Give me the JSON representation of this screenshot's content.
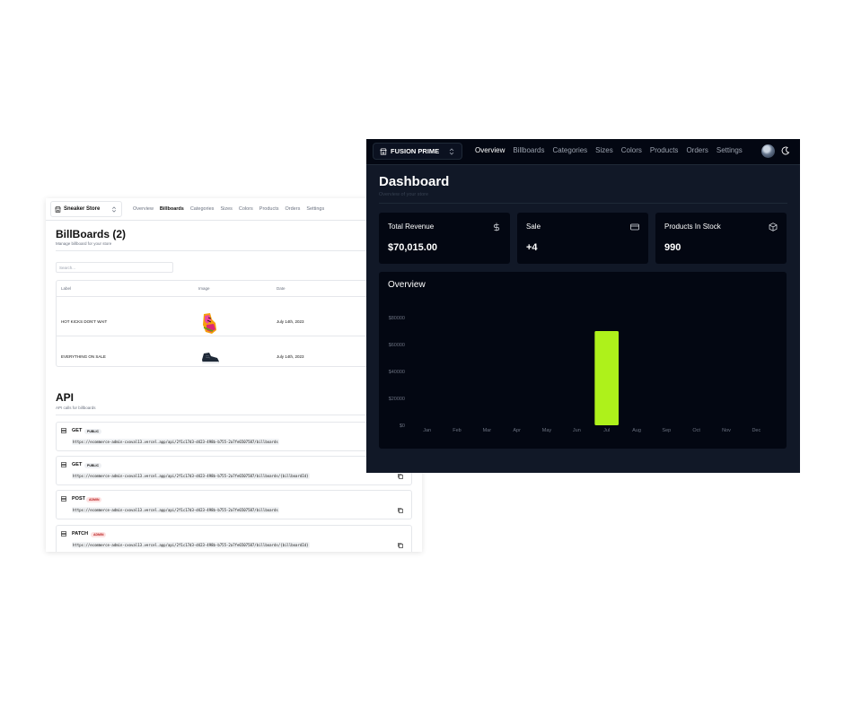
{
  "billboards_window": {
    "store_switcher": {
      "label": "Sneaker Store",
      "icon": "store-icon"
    },
    "nav": [
      {
        "label": "Overview",
        "active": false
      },
      {
        "label": "Billboards",
        "active": true
      },
      {
        "label": "Categories",
        "active": false
      },
      {
        "label": "Sizes",
        "active": false
      },
      {
        "label": "Colors",
        "active": false
      },
      {
        "label": "Products",
        "active": false
      },
      {
        "label": "Orders",
        "active": false
      },
      {
        "label": "Settings",
        "active": false
      }
    ],
    "heading": {
      "title": "BillBoards (2)",
      "subtitle": "Manage billboard for your store"
    },
    "search": {
      "placeholder": "Search..."
    },
    "table": {
      "headers": [
        "Label",
        "Image",
        "Date"
      ],
      "rows": [
        {
          "label": "HOT KICKS DON'T WAIT",
          "image": "sneaker-colorful",
          "date": "July 14th, 2023"
        },
        {
          "label": "EVERYTHING ON SALE",
          "image": "sneaker-black",
          "date": "July 14th, 2023"
        }
      ]
    },
    "api": {
      "title": "API",
      "subtitle": "API calls for billboards",
      "calls": [
        {
          "method": "GET",
          "badge": "PUBLIC",
          "url": "https://ecommerce-admin-cxoval13.vercel.app/api/2f1c17d3-d423-498b-b755-2a7fe6507587/billboards"
        },
        {
          "method": "GET",
          "badge": "PUBLIC",
          "url": "https://ecommerce-admin-cxoval13.vercel.app/api/2f1c17d3-d423-498b-b755-2a7fe6507587/billboards/{billboardId}"
        },
        {
          "method": "POST",
          "badge": "ADMIN",
          "url": "https://ecommerce-admin-cxoval13.vercel.app/api/2f1c17d3-d423-498b-b755-2a7fe6507587/billboards"
        },
        {
          "method": "PATCH",
          "badge": "ADMIN",
          "url": "https://ecommerce-admin-cxoval13.vercel.app/api/2f1c17d3-d423-498b-b755-2a7fe6507587/billboards/{billboardId}"
        }
      ]
    }
  },
  "dashboard_window": {
    "store_switcher": {
      "label": "FUSION PRIME",
      "icon": "store-icon"
    },
    "nav": [
      {
        "label": "Overview",
        "active": true
      },
      {
        "label": "Billboards",
        "active": false
      },
      {
        "label": "Categories",
        "active": false
      },
      {
        "label": "Sizes",
        "active": false
      },
      {
        "label": "Colors",
        "active": false
      },
      {
        "label": "Products",
        "active": false
      },
      {
        "label": "Orders",
        "active": false
      },
      {
        "label": "Settings",
        "active": false
      }
    ],
    "heading": {
      "title": "Dashboard",
      "subtitle": "Overview of your store"
    },
    "stats": [
      {
        "title": "Total Revenue",
        "value": "$70,015.00",
        "icon": "dollar-icon"
      },
      {
        "title": "Sale",
        "value": "+4",
        "icon": "credit-card-icon"
      },
      {
        "title": "Products In Stock",
        "value": "990",
        "icon": "package-icon"
      }
    ],
    "overview_title": "Overview",
    "accent_color": "#aef11b"
  },
  "chart_data": {
    "type": "bar",
    "title": "Overview",
    "categories": [
      "Jan",
      "Feb",
      "Mar",
      "Apr",
      "May",
      "Jun",
      "Jul",
      "Aug",
      "Sep",
      "Oct",
      "Nov",
      "Dec"
    ],
    "values": [
      0,
      0,
      0,
      0,
      0,
      0,
      70015,
      0,
      0,
      0,
      0,
      0
    ],
    "yticks": [
      "$0",
      "$20000",
      "$40000",
      "$60000",
      "$80000"
    ],
    "ylim": [
      0,
      80000
    ],
    "color": "#aef11b",
    "grid": false
  }
}
